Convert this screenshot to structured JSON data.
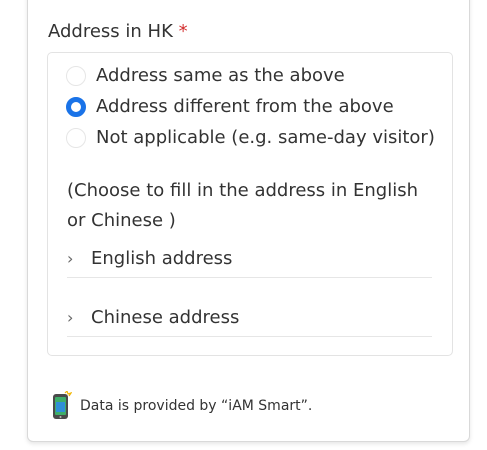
{
  "address_section": {
    "label": "Address in HK",
    "required_mark": "*",
    "options": [
      {
        "label": "Address same as the above",
        "checked": false
      },
      {
        "label": "Address different from the above",
        "checked": true
      },
      {
        "label": "Not applicable (e.g. same-day visitor)",
        "checked": false
      }
    ],
    "hint": "(Choose to fill in the address in English or Chinese )",
    "accordions": [
      {
        "label": "English address",
        "icon": "chevron-right-icon"
      },
      {
        "label": "Chinese address",
        "icon": "chevron-right-icon"
      }
    ]
  },
  "footnote": {
    "icon": "iam-smart-phone-icon",
    "text": "Data is provided by “iAM Smart”."
  },
  "colors": {
    "accent": "#1a73e8",
    "required": "#d32f2f",
    "text": "#333333",
    "border": "#e3e3e3"
  }
}
